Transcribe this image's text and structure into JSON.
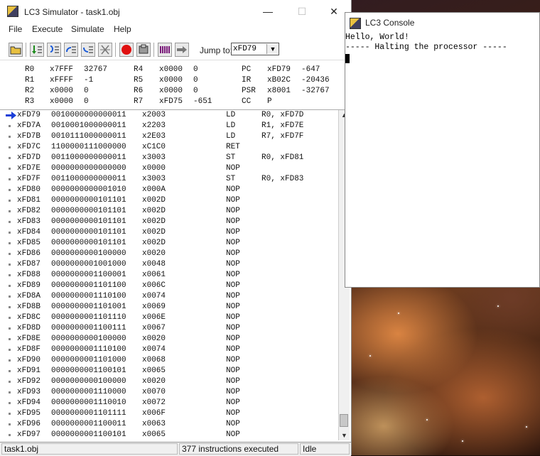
{
  "simulator": {
    "title": "LC3 Simulator - task1.obj",
    "window_buttons": {
      "minimize": "—",
      "maximize": "☐",
      "close": "✕"
    },
    "menu": [
      "File",
      "Execute",
      "Simulate",
      "Help"
    ],
    "jump_label": "Jump to:",
    "jump_value": "xFD79",
    "registers": [
      {
        "name": "R0",
        "hex": "x7FFF",
        "dec": "32767"
      },
      {
        "name": "R1",
        "hex": "xFFFF",
        "dec": "-1"
      },
      {
        "name": "R2",
        "hex": "x0000",
        "dec": "0"
      },
      {
        "name": "R3",
        "hex": "x0000",
        "dec": "0"
      },
      {
        "name": "R4",
        "hex": "x0000",
        "dec": "0"
      },
      {
        "name": "R5",
        "hex": "x0000",
        "dec": "0"
      },
      {
        "name": "R6",
        "hex": "x0000",
        "dec": "0"
      },
      {
        "name": "R7",
        "hex": "xFD75",
        "dec": "-651"
      },
      {
        "name": "PC",
        "hex": "xFD79",
        "dec": "-647"
      },
      {
        "name": "IR",
        "hex": "xB02C",
        "dec": "-20436"
      },
      {
        "name": "PSR",
        "hex": "x8001",
        "dec": "-32767"
      },
      {
        "name": "CC",
        "hex": "P",
        "dec": ""
      }
    ],
    "code": [
      {
        "addr": "xFD79",
        "bin": "0010000000000011",
        "hex": "x2003",
        "op": "LD",
        "args": "R0, xFD7D"
      },
      {
        "addr": "xFD7A",
        "bin": "0010001000000011",
        "hex": "x2203",
        "op": "LD",
        "args": "R1, xFD7E"
      },
      {
        "addr": "xFD7B",
        "bin": "0010111000000011",
        "hex": "x2E03",
        "op": "LD",
        "args": "R7, xFD7F"
      },
      {
        "addr": "xFD7C",
        "bin": "1100000111000000",
        "hex": "xC1C0",
        "op": "RET",
        "args": ""
      },
      {
        "addr": "xFD7D",
        "bin": "0011000000000011",
        "hex": "x3003",
        "op": "ST",
        "args": "R0, xFD81"
      },
      {
        "addr": "xFD7E",
        "bin": "0000000000000000",
        "hex": "x0000",
        "op": "NOP",
        "args": ""
      },
      {
        "addr": "xFD7F",
        "bin": "0011000000000011",
        "hex": "x3003",
        "op": "ST",
        "args": "R0, xFD83"
      },
      {
        "addr": "xFD80",
        "bin": "0000000000001010",
        "hex": "x000A",
        "op": "NOP",
        "args": ""
      },
      {
        "addr": "xFD81",
        "bin": "0000000000101101",
        "hex": "x002D",
        "op": "NOP",
        "args": ""
      },
      {
        "addr": "xFD82",
        "bin": "0000000000101101",
        "hex": "x002D",
        "op": "NOP",
        "args": ""
      },
      {
        "addr": "xFD83",
        "bin": "0000000000101101",
        "hex": "x002D",
        "op": "NOP",
        "args": ""
      },
      {
        "addr": "xFD84",
        "bin": "0000000000101101",
        "hex": "x002D",
        "op": "NOP",
        "args": ""
      },
      {
        "addr": "xFD85",
        "bin": "0000000000101101",
        "hex": "x002D",
        "op": "NOP",
        "args": ""
      },
      {
        "addr": "xFD86",
        "bin": "0000000000100000",
        "hex": "x0020",
        "op": "NOP",
        "args": ""
      },
      {
        "addr": "xFD87",
        "bin": "0000000001001000",
        "hex": "x0048",
        "op": "NOP",
        "args": ""
      },
      {
        "addr": "xFD88",
        "bin": "0000000001100001",
        "hex": "x0061",
        "op": "NOP",
        "args": ""
      },
      {
        "addr": "xFD89",
        "bin": "0000000001101100",
        "hex": "x006C",
        "op": "NOP",
        "args": ""
      },
      {
        "addr": "xFD8A",
        "bin": "0000000001110100",
        "hex": "x0074",
        "op": "NOP",
        "args": ""
      },
      {
        "addr": "xFD8B",
        "bin": "0000000001101001",
        "hex": "x0069",
        "op": "NOP",
        "args": ""
      },
      {
        "addr": "xFD8C",
        "bin": "0000000001101110",
        "hex": "x006E",
        "op": "NOP",
        "args": ""
      },
      {
        "addr": "xFD8D",
        "bin": "0000000001100111",
        "hex": "x0067",
        "op": "NOP",
        "args": ""
      },
      {
        "addr": "xFD8E",
        "bin": "0000000000100000",
        "hex": "x0020",
        "op": "NOP",
        "args": ""
      },
      {
        "addr": "xFD8F",
        "bin": "0000000001110100",
        "hex": "x0074",
        "op": "NOP",
        "args": ""
      },
      {
        "addr": "xFD90",
        "bin": "0000000001101000",
        "hex": "x0068",
        "op": "NOP",
        "args": ""
      },
      {
        "addr": "xFD91",
        "bin": "0000000001100101",
        "hex": "x0065",
        "op": "NOP",
        "args": ""
      },
      {
        "addr": "xFD92",
        "bin": "0000000000100000",
        "hex": "x0020",
        "op": "NOP",
        "args": ""
      },
      {
        "addr": "xFD93",
        "bin": "0000000001110000",
        "hex": "x0070",
        "op": "NOP",
        "args": ""
      },
      {
        "addr": "xFD94",
        "bin": "0000000001110010",
        "hex": "x0072",
        "op": "NOP",
        "args": ""
      },
      {
        "addr": "xFD95",
        "bin": "0000000001101111",
        "hex": "x006F",
        "op": "NOP",
        "args": ""
      },
      {
        "addr": "xFD96",
        "bin": "0000000001100011",
        "hex": "x0063",
        "op": "NOP",
        "args": ""
      },
      {
        "addr": "xFD97",
        "bin": "0000000001100101",
        "hex": "x0065",
        "op": "NOP",
        "args": ""
      }
    ],
    "status": {
      "file": "task1.obj",
      "executed": "377 instructions executed",
      "state": "Idle"
    },
    "colors": {
      "pc_arrow": "#1a3fd8",
      "breakpoint_button": "#e01010"
    },
    "toolbar_icons": [
      "open-folder-icon",
      "step-in-icon",
      "step-over-icon",
      "step-out-icon",
      "run-to-icon",
      "breakpoint-toggle-icon",
      "stop-icon",
      "reset-icon",
      "memory-icon",
      "go-icon"
    ]
  },
  "console": {
    "title": "LC3 Console",
    "lines": [
      "Hello, World!",
      "----- Halting the processor -----"
    ]
  }
}
